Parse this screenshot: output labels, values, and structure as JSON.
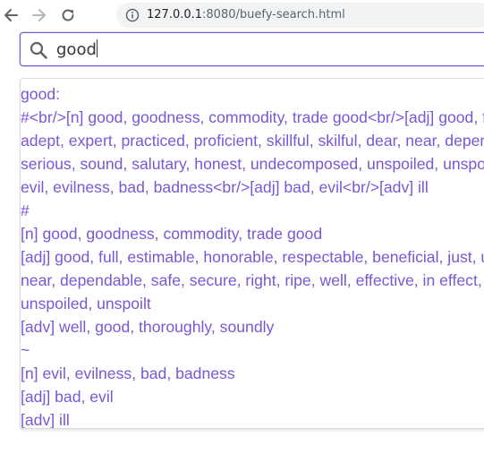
{
  "browser": {
    "back_icon": "arrow-left-icon",
    "forward_icon": "arrow-right-icon",
    "reload_icon": "reload-icon",
    "info_icon": "info-circle-icon",
    "url_host": "127.0.0.1",
    "url_rest": ":8080/buefy-search.html"
  },
  "search": {
    "icon": "search-icon",
    "value": "good",
    "accent_color": "#7957d5"
  },
  "results": [
    "good:",
    "#<br/>[n] good, goodness, commodity, trade good<br/>[adj] good, full, estimable, honorable, respectable, beneficial, just, upright,",
    "adept, expert, practiced, proficient, skillful, skilful, dear, near, dependable, safe, secure, right, ripe, well, effective, in effect, in force,",
    "serious, sound, salutary, honest, undecomposed, unspoiled, unspoilt<br/>[adv] well, good, thoroughly, soundly<br/>~<br/>[n]",
    "evil, evilness, bad, badness<br/>[adj] bad, evil<br/>[adv] ill",
    "#",
    "[n] good, goodness, commodity, trade good",
    "[adj] good, full, estimable, honorable, respectable, beneficial, just, upright, adept, expert, practiced, proficient, skillful, skilful, dear,",
    "near, dependable, safe, secure, right, ripe, well, effective, in effect, in force, serious, sound, salutary, honest, undecomposed,",
    "unspoiled, unspoilt",
    "[adv] well, good, thoroughly, soundly",
    "~",
    "[n] evil, evilness, bad, badness",
    "[adj] bad, evil",
    "[adv] ill"
  ]
}
